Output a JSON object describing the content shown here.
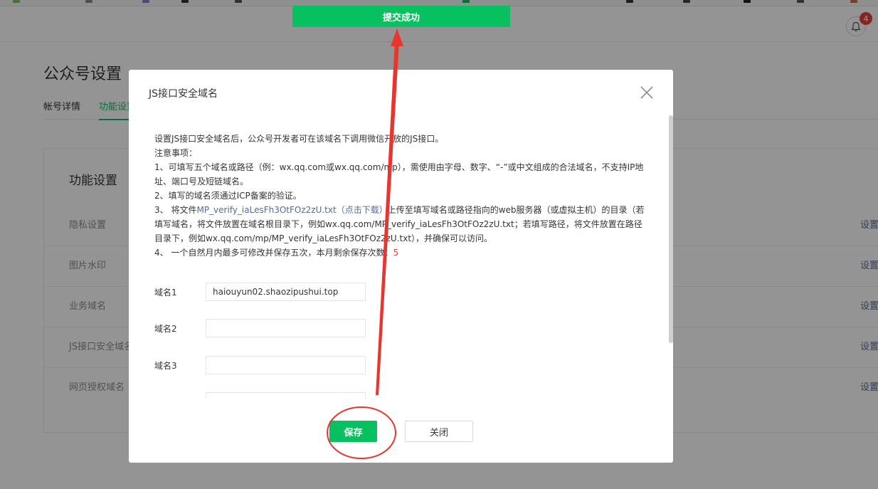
{
  "header": {
    "notification_count": "4"
  },
  "page": {
    "title": "公众号设置",
    "tabs": [
      {
        "label": "帐号详情",
        "active": false
      },
      {
        "label": "功能设置",
        "active": true
      }
    ]
  },
  "panel": {
    "title": "功能设置",
    "rows": [
      {
        "label": "隐私设置",
        "action": "设置"
      },
      {
        "label": "图片水印",
        "action": "设置"
      },
      {
        "label": "业务域名",
        "action": "设置"
      },
      {
        "label": "JS接口安全域名",
        "action": "设置"
      },
      {
        "label": "网页授权域名",
        "action": "设置"
      }
    ]
  },
  "toast": {
    "text": "提交成功"
  },
  "dialog": {
    "title": "JS接口安全域名",
    "intro": "设置JS接口安全域名后，公众号开发者可在该域名下调用微信开放的JS接口。",
    "notice_heading": "注意事项：",
    "item1": "1、可填写五个域名或路径（例：wx.qq.com或wx.qq.com/mp），需使用由字母、数字、“-”或中文组成的合法域名，不支持IP地址、端口号及短链域名。",
    "item2": "2、填写的域名须通过ICP备案的验证。",
    "item3_prefix": "3、 将文件",
    "item3_link": "MP_verify_iaLesFh3OtFOz2zU.txt（点击下载）",
    "item3_suffix": "上传至填写域名或路径指向的web服务器（或虚拟主机）的目录（若填写域名，将文件放置在域名根目录下，例如wx.qq.com/MP_verify_iaLesFh3OtFOz2zU.txt；若填写路径，将文件放置在路径目录下，例如wx.qq.com/mp/MP_verify_iaLesFh3OtFOz2zU.txt），并确保可以访问。",
    "item4_prefix": "4、 一个自然月内最多可修改并保存五次，本月剩余保存次数：",
    "item4_count": "5",
    "fields": [
      {
        "label": "域名1",
        "value": "haiouyun02.shaozipushui.top"
      },
      {
        "label": "域名2",
        "value": ""
      },
      {
        "label": "域名3",
        "value": ""
      }
    ],
    "save_label": "保存",
    "close_label": "关闭"
  },
  "colors": {
    "brand_green": "#07c160",
    "link_blue": "#576b95",
    "alert_red": "#e64340",
    "annotation_red": "#e8352e"
  }
}
